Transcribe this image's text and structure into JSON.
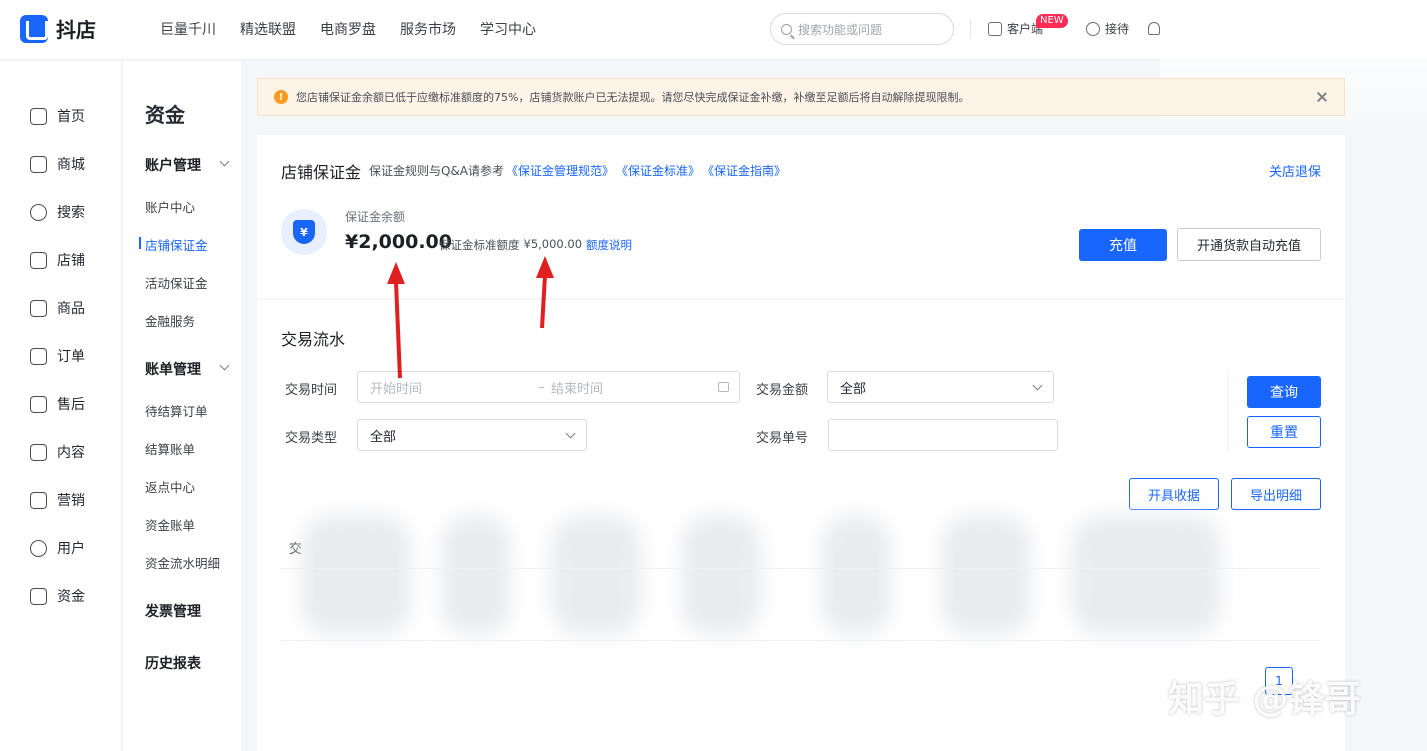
{
  "header": {
    "logo_text": "抖店",
    "nav": [
      "巨量千川",
      "精选联盟",
      "电商罗盘",
      "服务市场",
      "学习中心"
    ],
    "search_placeholder": "搜索功能或问题",
    "customer_service": "客户端",
    "new_badge": "NEW",
    "reception": "接待"
  },
  "sidebar": {
    "items": [
      "首页",
      "商城",
      "搜索",
      "店铺",
      "商品",
      "订单",
      "售后",
      "内容",
      "营销",
      "用户",
      "资金"
    ]
  },
  "submenu": {
    "title": "资金",
    "account_group": "账户管理",
    "account_items": [
      "账户中心",
      "店铺保证金",
      "活动保证金",
      "金融服务"
    ],
    "bill_group": "账单管理",
    "bill_items": [
      "待结算订单",
      "结算账单",
      "返点中心",
      "资金账单",
      "资金流水明细"
    ],
    "invoice_group": "发票管理",
    "history_group": "历史报表"
  },
  "notice": {
    "text": "您店铺保证金余额已低于应缴标准额度的75%，店铺货款账户已无法提现。请您尽快完成保证金补缴，补缴至足额后将自动解除提现限制。"
  },
  "deposit": {
    "title": "店铺保证金",
    "ref_prefix": "保证金规则与Q&A请参考",
    "links": [
      "《保证金管理规范》",
      "《保证金标准》",
      "《保证金指南》"
    ],
    "exit_link": "关店退保",
    "shield_symbol": "¥",
    "balance_label": "保证金余额",
    "balance": "¥2,000.00",
    "standard_label": "保证金标准额度",
    "standard_value": "¥5,000.00",
    "quota_link": "额度说明",
    "recharge_button": "充值",
    "auto_recharge_button": "开通货款自动充值"
  },
  "transactions": {
    "title": "交易流水",
    "time_label": "交易时间",
    "start_placeholder": "开始时间",
    "range_sep": "–",
    "end_placeholder": "结束时间",
    "amount_label": "交易金额",
    "amount_value": "全部",
    "type_label": "交易类型",
    "type_value": "全部",
    "order_label": "交易单号",
    "query_button": "查询",
    "reset_button": "重置",
    "receipt_button": "开具收据",
    "export_button": "导出明细",
    "table_header_fragment": "交",
    "page_button": "1"
  },
  "watermark": "知乎 @锋哥",
  "colors": {
    "brand": "#1966ff",
    "warning": "#ff9b1f",
    "badge": "#fe2c55",
    "arrow": "#e02020"
  }
}
